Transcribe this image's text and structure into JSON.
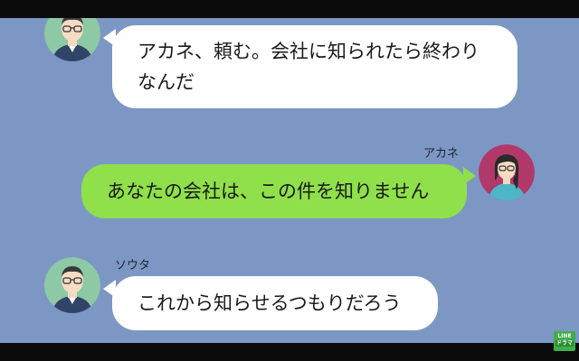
{
  "messages": [
    {
      "sender": "",
      "text_line1": "アカネ、頼む。会社に知られたら終わり",
      "text_line2": "なんだ"
    },
    {
      "sender": "アカネ",
      "text": "あなたの会社は、この件を知りません"
    },
    {
      "sender": "ソウタ",
      "text": "これから知らせるつもりだろう"
    }
  ],
  "watermark": {
    "line1": "LINE",
    "line2": "ドラマ"
  },
  "colors": {
    "background": "#7d97c4",
    "incoming_bubble": "#ffffff",
    "outgoing_bubble": "#8fe04a",
    "letterbox": "#0b0b0b",
    "logo": "#3fae49"
  },
  "icons": {
    "sota_avatar": "man-with-glasses-avatar",
    "akane_avatar": "woman-with-glasses-avatar"
  }
}
